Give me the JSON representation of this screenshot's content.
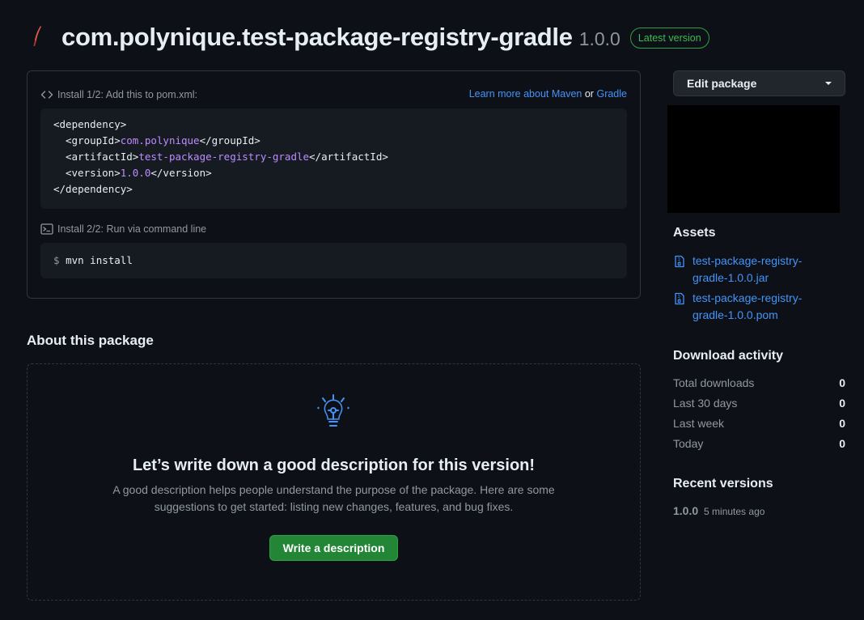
{
  "header": {
    "icon": "java-icon",
    "title": "com.polynique.test-package-registry-gradle",
    "version": "1.0.0",
    "badge": "Latest version"
  },
  "install": {
    "step1_label": "Install 1/2: Add this to pom.xml:",
    "learn_more_prefix": "Learn more about Maven",
    "learn_more_or": "or",
    "learn_more_gradle": "Gradle",
    "xml": {
      "open_dependency": "<dependency>",
      "group_open": "<groupId>",
      "group_value": "com.polynique",
      "group_close": "</groupId>",
      "artifact_open": "<artifactId>",
      "artifact_value": "test-package-registry-gradle",
      "artifact_close": "</artifactId>",
      "version_open": "<version>",
      "version_value": "1.0.0",
      "version_close": "</version>",
      "close_dependency": "</dependency>"
    },
    "step2_label": "Install 2/2: Run via command line",
    "prompt": "$",
    "command": "mvn install"
  },
  "about": {
    "title": "About this package",
    "blank_title": "Let’s write down a good description for this version!",
    "blank_desc": "A good description helps people understand the purpose of the package. Here are some suggestions to get started: listing new changes, features, and bug fixes.",
    "button": "Write a description"
  },
  "sidebar": {
    "edit_button": "Edit package",
    "assets_title": "Assets",
    "assets": [
      "test-package-registry-gradle-1.0.0.jar",
      "test-package-registry-gradle-1.0.0.pom"
    ],
    "download_title": "Download activity",
    "stats": [
      {
        "label": "Total downloads",
        "value": "0"
      },
      {
        "label": "Last 30 days",
        "value": "0"
      },
      {
        "label": "Last week",
        "value": "0"
      },
      {
        "label": "Today",
        "value": "0"
      }
    ],
    "recent_title": "Recent versions",
    "recent_version": "1.0.0",
    "recent_time": "5 minutes ago"
  },
  "colors": {
    "background": "#0d1117",
    "link": "#4493f8",
    "accent_green": "#238636",
    "code_value": "#bc8cff"
  }
}
